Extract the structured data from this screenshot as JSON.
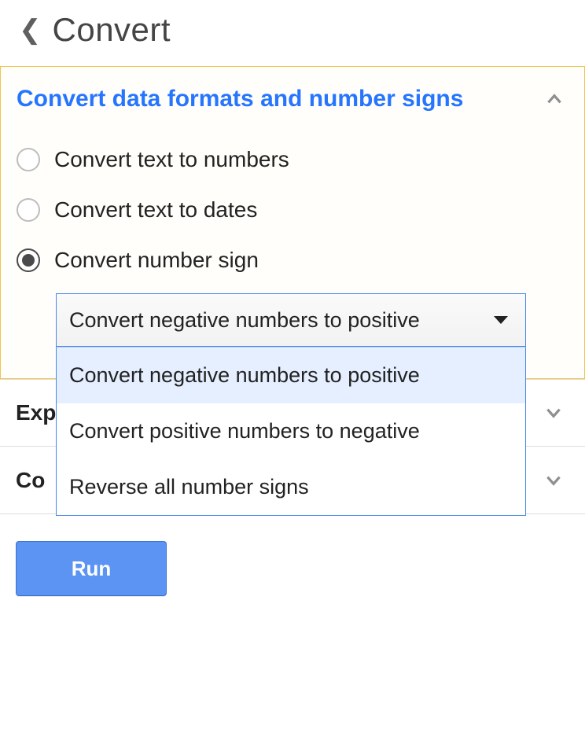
{
  "header": {
    "title": "Convert"
  },
  "panel": {
    "title": "Convert data formats and number signs",
    "options": [
      {
        "label": "Convert text to numbers",
        "selected": false
      },
      {
        "label": "Convert text to dates",
        "selected": false
      },
      {
        "label": "Convert number sign",
        "selected": true
      }
    ],
    "select": {
      "value": "Convert negative numbers to positive",
      "items": [
        "Convert negative numbers to positive",
        "Convert positive numbers to negative",
        "Reverse all number signs"
      ],
      "highlightedIndex": 0
    }
  },
  "collapsed": [
    {
      "label": "Exp"
    },
    {
      "label": "Co"
    }
  ],
  "actions": {
    "run": "Run"
  },
  "colors": {
    "accent": "#2675ff",
    "panelBorder": "#f0c54d",
    "button": "#5b94f2"
  }
}
